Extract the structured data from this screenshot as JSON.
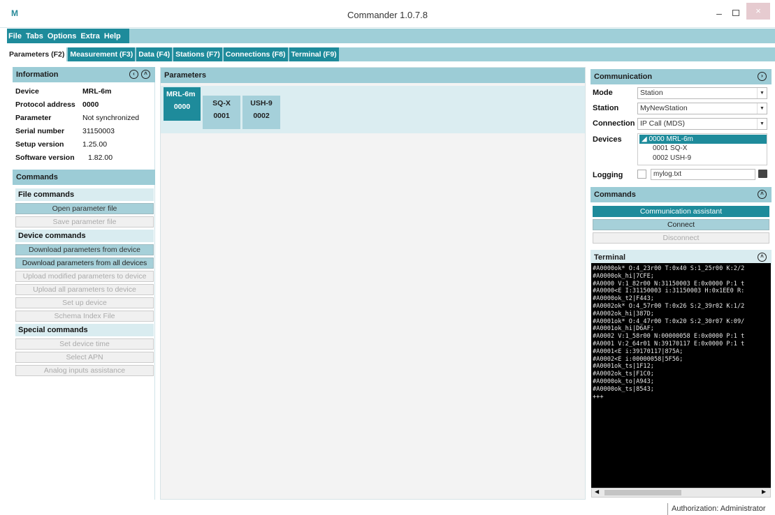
{
  "window": {
    "logo": "M",
    "title": "Commander 1.0.7.8",
    "minimize": "–",
    "close": "×"
  },
  "menu": [
    "File",
    "Tabs",
    "Options",
    "Extra",
    "Help"
  ],
  "tabs": [
    {
      "label": "Parameters (F2)",
      "active": true
    },
    {
      "label": "Measurement (F3)",
      "active": false
    },
    {
      "label": "Data (F4)",
      "active": false
    },
    {
      "label": "Stations (F7)",
      "active": false
    },
    {
      "label": "Connections (F8)",
      "active": false
    },
    {
      "label": "Terminal (F9)",
      "active": false
    }
  ],
  "information": {
    "title": "Information",
    "rows": [
      {
        "label": "Device",
        "value": "MRL-6m",
        "bold": true
      },
      {
        "label": "Protocol address",
        "value": "0000",
        "bold": true
      },
      {
        "label": "Parameter",
        "value": "Not synchronized",
        "bold": false
      },
      {
        "label": "Serial number",
        "value": "31150003",
        "bold": false
      },
      {
        "label": "Setup version",
        "value": "1.25.00",
        "bold": false
      },
      {
        "label": "Software version",
        "value": "1.82.00",
        "bold": false
      }
    ]
  },
  "commands": {
    "title": "Commands",
    "file_title": "File commands",
    "open_param": "Open parameter file",
    "save_param": "Save parameter file",
    "device_title": "Device commands",
    "download_device": "Download parameters from device",
    "download_all": "Download parameters from all devices",
    "upload_modified": "Upload modified parameters to device",
    "upload_all": "Upload all parameters to device",
    "setup_device": "Set up device",
    "schema_index": "Schema Index File",
    "special_title": "Special commands",
    "set_time": "Set device time",
    "select_apn": "Select APN",
    "analog": "Analog inputs assistance"
  },
  "parameters": {
    "title": "Parameters",
    "devices": [
      {
        "name": "MRL-6m",
        "address": "0000",
        "selected": true
      },
      {
        "name": "SQ-X",
        "address": "0001",
        "selected": false
      },
      {
        "name": "USH-9",
        "address": "0002",
        "selected": false
      }
    ]
  },
  "communication": {
    "title": "Communication",
    "mode_label": "Mode",
    "mode_value": "Station",
    "station_label": "Station",
    "station_value": "MyNewStation",
    "connection_label": "Connection",
    "connection_value": "IP Call (MDS)",
    "devices_label": "Devices",
    "tree_root": "0000 MRL-6m",
    "tree_child1": "0001 SQ-X",
    "tree_child2": "0002 USH-9",
    "logging_label": "Logging",
    "logging_file": "mylog.txt"
  },
  "comm_commands": {
    "title": "Commands",
    "assistant": "Communication assistant",
    "connect": "Connect",
    "disconnect": "Disconnect"
  },
  "terminal": {
    "title": "Terminal",
    "text": "#A0000ok* O:4_23r00 T:0x40 S:1_25r00 K:2/2\n#A0000ok_hi|7CFE;\n#A0000 V:1_82r00 N:31150003 E:0x0000 P:1 t\n#A0000<E I:31150003 i:31150003 H:0x1EE0 R:\n#A0000ok_t2|F443;\n#A0002ok* O:4_57r00 T:0x26 S:2_39r02 K:1/2\n#A0002ok_hi|387D;\n#A0001ok* O:4_47r00 T:0x20 S:2_30r07 K:09/\n#A0001ok_hi|D6AF;\n#A0002 V:1_58r00 N:00000058 E:0x0000 P:1 t\n#A0001 V:2_64r01 N:39170117 E:0x0000 P:1 t\n#A0001<E i:39170117|875A;\n#A0002<E i:00000058|5F56;\n#A0001ok_ts|1F12;\n#A0002ok_ts|F1C0;\n#A0000ok_to|A943;\n#A0000ok_ts|8543;\n+++"
  },
  "status": {
    "authorization": "Authorization: Administrator"
  }
}
